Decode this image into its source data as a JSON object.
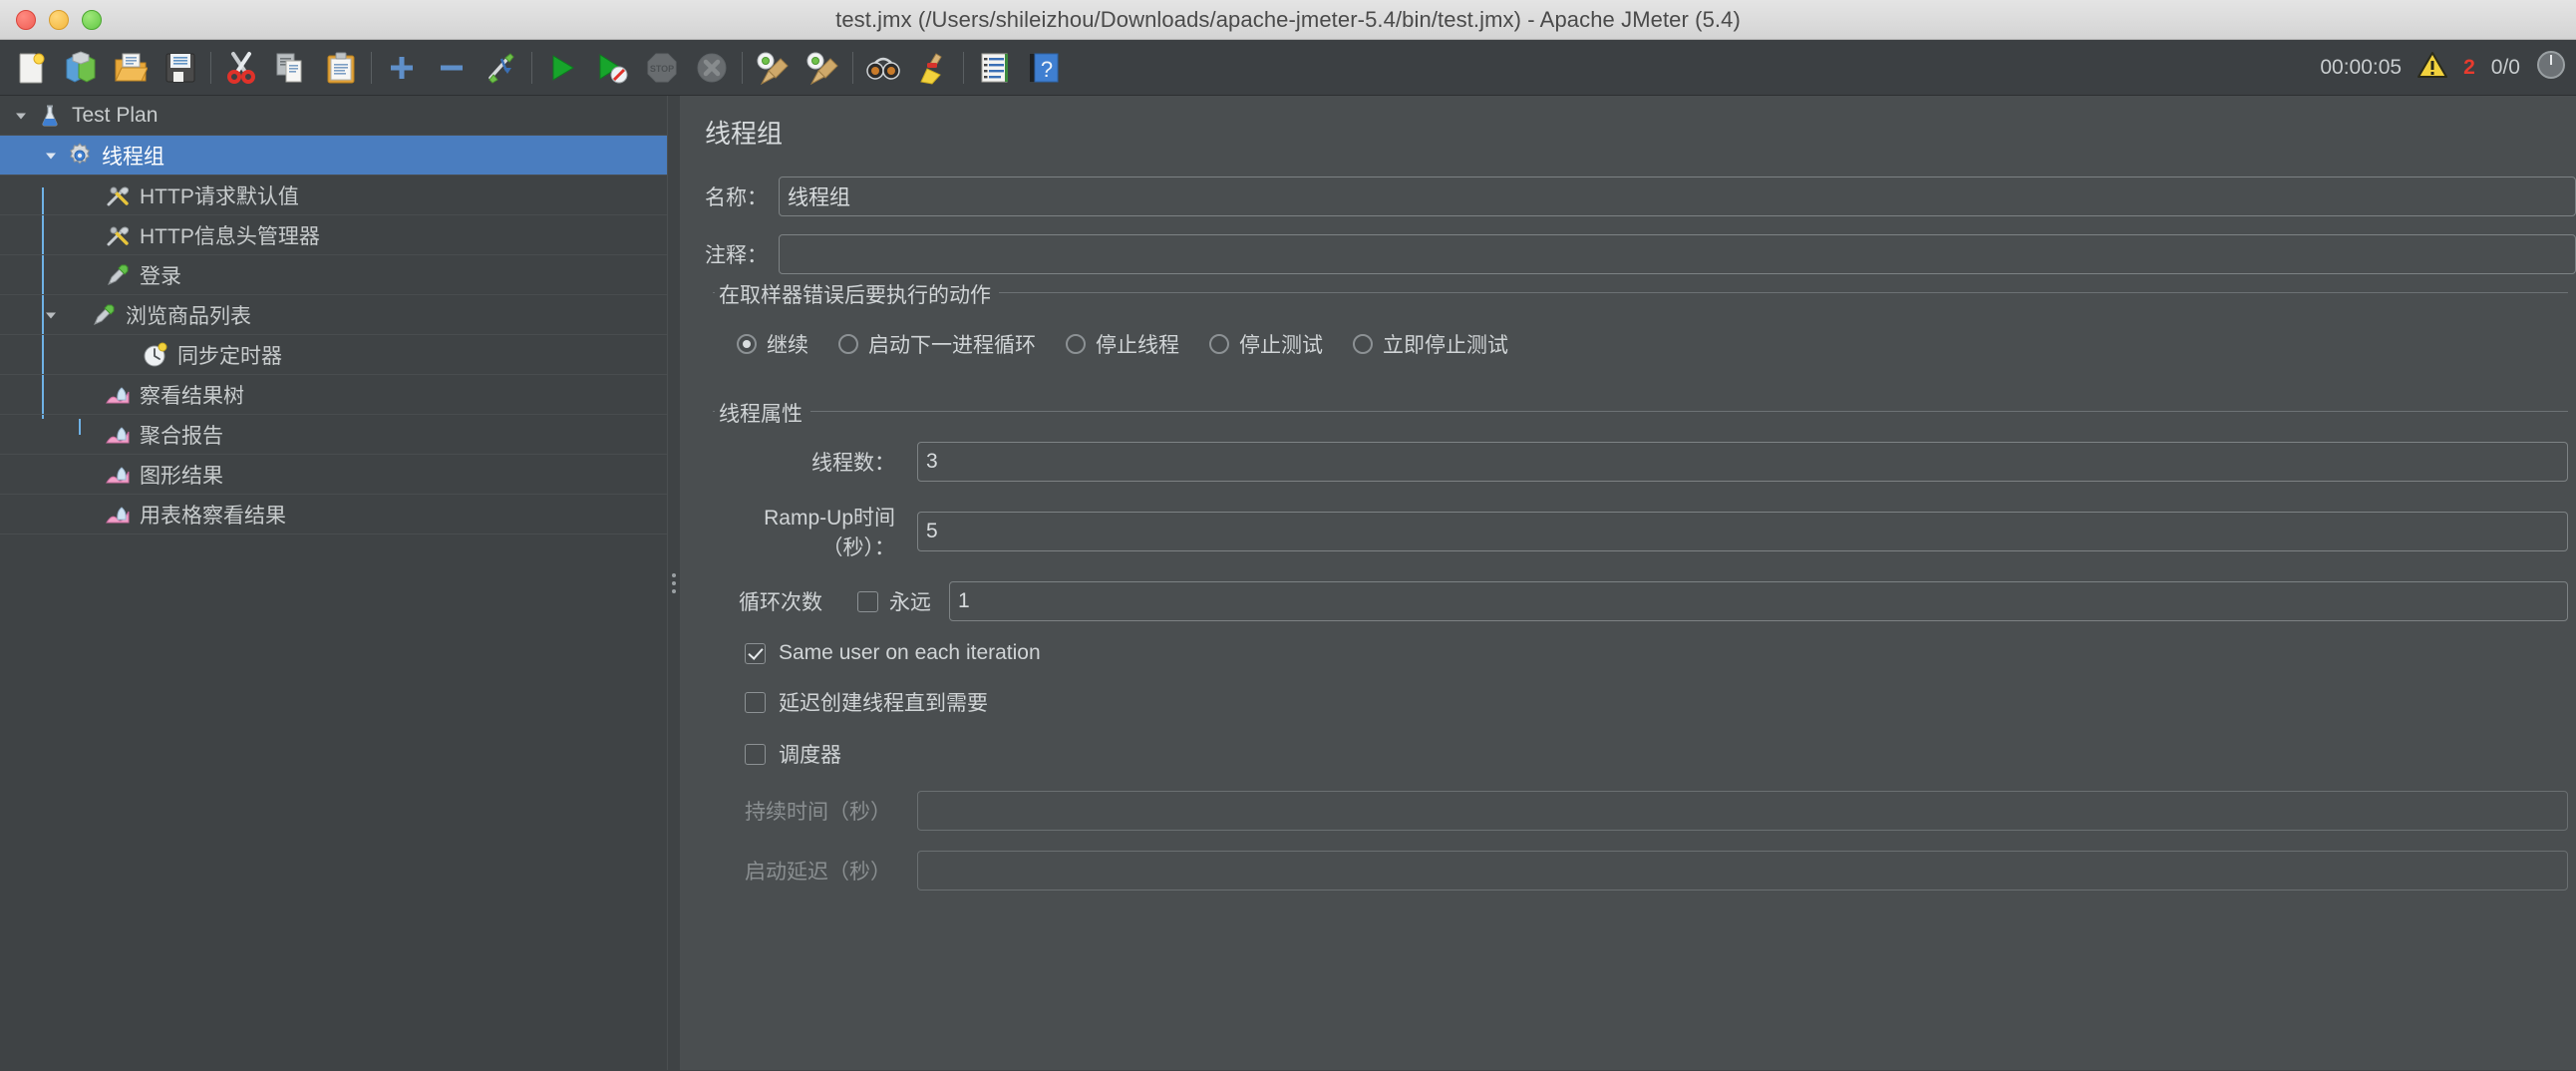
{
  "window": {
    "title": "test.jmx (/Users/shileizhou/Downloads/apache-jmeter-5.4/bin/test.jmx) - Apache JMeter (5.4)",
    "close_label": "close",
    "minimize_label": "minimize",
    "zoom_label": "zoom"
  },
  "toolbar": {
    "buttons": [
      {
        "name": "new-icon",
        "tip": "New"
      },
      {
        "name": "templates-icon",
        "tip": "Templates"
      },
      {
        "name": "open-icon",
        "tip": "Open"
      },
      {
        "name": "save-icon",
        "tip": "Save Test Plan"
      },
      {
        "name": "cut-icon",
        "tip": "Cut"
      },
      {
        "name": "copy-icon",
        "tip": "Copy"
      },
      {
        "name": "paste-icon",
        "tip": "Paste"
      },
      {
        "name": "expand-all-icon",
        "tip": "Expand All"
      },
      {
        "name": "collapse-all-icon",
        "tip": "Collapse All"
      },
      {
        "name": "toggle-icon",
        "tip": "Toggle"
      },
      {
        "name": "start-icon",
        "tip": "Start"
      },
      {
        "name": "start-no-pauses-icon",
        "tip": "Start no pauses"
      },
      {
        "name": "stop-icon",
        "tip": "Stop"
      },
      {
        "name": "shutdown-icon",
        "tip": "Shutdown"
      },
      {
        "name": "clear-icon",
        "tip": "Clear"
      },
      {
        "name": "clear-all-icon",
        "tip": "Clear All"
      },
      {
        "name": "search-icon",
        "tip": "Search"
      },
      {
        "name": "reset-search-icon",
        "tip": "Reset Search"
      },
      {
        "name": "function-helper-icon",
        "tip": "Function Helper Dialog"
      },
      {
        "name": "help-icon",
        "tip": "Help"
      }
    ],
    "status": {
      "elapsed": "00:00:05",
      "warning_icon": "warning-triangle-icon",
      "warning_count": "2",
      "running_threads": "0/0"
    }
  },
  "tree": {
    "nodes": [
      {
        "label": "Test Plan",
        "icon": "test-plan-icon",
        "depth": 0,
        "expander": "down",
        "selected": false
      },
      {
        "label": "线程组",
        "icon": "thread-group-icon",
        "depth": 1,
        "expander": "down",
        "selected": true
      },
      {
        "label": "HTTP请求默认值",
        "icon": "config-element-icon",
        "depth": 2,
        "expander": "none",
        "selected": false
      },
      {
        "label": "HTTP信息头管理器",
        "icon": "config-element-icon",
        "depth": 2,
        "expander": "none",
        "selected": false
      },
      {
        "label": "登录",
        "icon": "sampler-icon",
        "depth": 2,
        "expander": "none",
        "selected": false
      },
      {
        "label": "浏览商品列表",
        "icon": "sampler-icon",
        "depth": 2,
        "expander": "down",
        "selected": false
      },
      {
        "label": "同步定时器",
        "icon": "timer-icon",
        "depth": 3,
        "expander": "none",
        "selected": false
      },
      {
        "label": "察看结果树",
        "icon": "listener-icon",
        "depth": 2,
        "expander": "none",
        "selected": false
      },
      {
        "label": "聚合报告",
        "icon": "listener-icon",
        "depth": 2,
        "expander": "none",
        "selected": false
      },
      {
        "label": "图形结果",
        "icon": "listener-icon",
        "depth": 2,
        "expander": "none",
        "selected": false
      },
      {
        "label": "用表格察看结果",
        "icon": "listener-icon",
        "depth": 2,
        "expander": "none",
        "selected": false
      }
    ]
  },
  "editor": {
    "heading": "线程组",
    "name_label": "名称：",
    "name_value": "线程组",
    "comment_label": "注释：",
    "comment_value": "",
    "on_error": {
      "group_title": "在取样器错误后要执行的动作",
      "options": [
        {
          "label": "继续",
          "selected": true
        },
        {
          "label": "启动下一进程循环",
          "selected": false
        },
        {
          "label": "停止线程",
          "selected": false
        },
        {
          "label": "停止测试",
          "selected": false
        },
        {
          "label": "立即停止测试",
          "selected": false
        }
      ]
    },
    "thread_props": {
      "group_title": "线程属性",
      "num_threads_label": "线程数：",
      "num_threads_value": "3",
      "ramp_up_label": "Ramp-Up时间（秒）：",
      "ramp_up_value": "5",
      "loop_label": "循环次数",
      "forever_label": "永远",
      "forever_checked": false,
      "loop_value": "1",
      "same_user_label": "Same user on each iteration",
      "same_user_checked": true,
      "delayed_start_label": "延迟创建线程直到需要",
      "delayed_start_checked": false,
      "scheduler_label": "调度器",
      "scheduler_checked": false,
      "duration_label": "持续时间（秒）",
      "duration_value": "",
      "startup_delay_label": "启动延迟（秒）",
      "startup_delay_value": ""
    }
  },
  "colors": {
    "selection_blue": "#4a7dbf",
    "panel_bg": "#4a4e50",
    "tree_bg": "#3f4345",
    "toolbar_bg": "#3c4043",
    "warning_red": "#e83b2e",
    "guide_line": "#6fb2e6"
  }
}
